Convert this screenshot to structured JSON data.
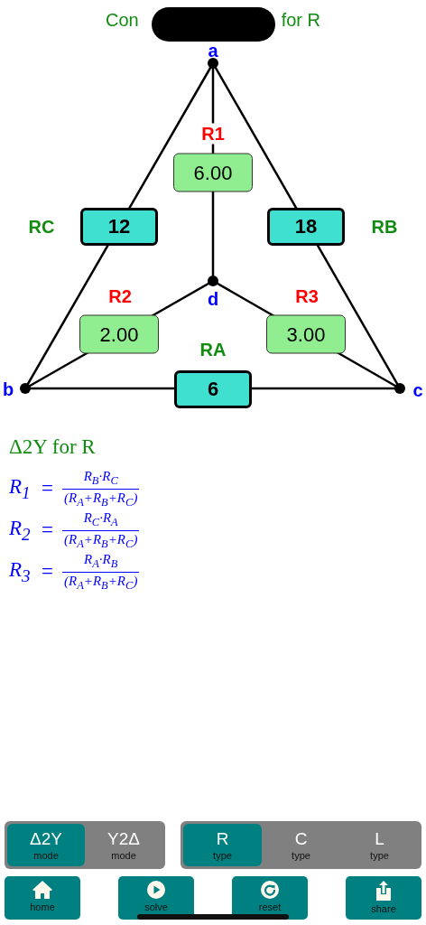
{
  "title": {
    "visible_start": "Con",
    "visible_end": "for R"
  },
  "diagram": {
    "nodes": [
      {
        "label": "a"
      },
      {
        "label": "b"
      },
      {
        "label": "c"
      },
      {
        "label": "d"
      }
    ],
    "resistor_labels": [
      {
        "text": "R1",
        "kind": "y"
      },
      {
        "text": "RC",
        "kind": "delta"
      },
      {
        "text": "RB",
        "kind": "delta"
      },
      {
        "text": "R2",
        "kind": "y"
      },
      {
        "text": "R3",
        "kind": "y"
      },
      {
        "text": "RA",
        "kind": "delta"
      }
    ],
    "resistor_values": [
      {
        "value": "6.00",
        "kind": "y"
      },
      {
        "value": "12",
        "kind": "delta"
      },
      {
        "value": "18",
        "kind": "delta"
      },
      {
        "value": "2.00",
        "kind": "y"
      },
      {
        "value": "3.00",
        "kind": "y"
      },
      {
        "value": "6",
        "kind": "delta"
      }
    ]
  },
  "formulas": {
    "heading": "Δ2Y for R",
    "rows": [
      {
        "lhs": "R$_{1}$",
        "eq": "=",
        "numerator": "R$_{B}$·R$_{C}$",
        "denominator": "(R$_{A}$+R$_{B}$+R$_{C}$)"
      },
      {
        "lhs": "R$_{2}$",
        "eq": "=",
        "numerator": "R$_{C}$·R$_{A}$",
        "denominator": "(R$_{A}$+R$_{B}$+R$_{C}$)"
      },
      {
        "lhs": "R$_{3}$",
        "eq": "=",
        "numerator": "R$_{A}$·R$_{B}$",
        "denominator": "(R$_{A}$+R$_{B}$+R$_{C}$)"
      }
    ]
  },
  "mode_segments": [
    {
      "label": "Δ2Y",
      "caption": "mode",
      "selected": true
    },
    {
      "label": "Y2Δ",
      "caption": "mode",
      "selected": false
    }
  ],
  "type_segments": [
    {
      "label": "R",
      "caption": "type",
      "selected": true
    },
    {
      "label": "C",
      "caption": "type",
      "selected": false
    },
    {
      "label": "L",
      "caption": "type",
      "selected": false
    }
  ],
  "actions": [
    {
      "label": "home",
      "kind": "home"
    },
    {
      "label": "solve",
      "kind": "solve"
    },
    {
      "label": "reset",
      "kind": "reset"
    },
    {
      "label": "share",
      "kind": "share"
    }
  ]
}
